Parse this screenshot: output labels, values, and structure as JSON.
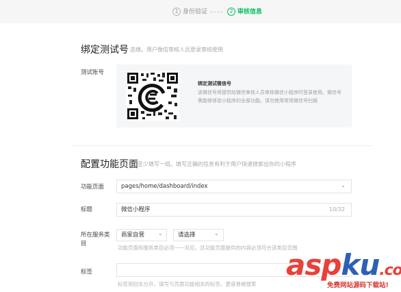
{
  "steps": {
    "step1_num": "1",
    "step1_label": "身份验证",
    "step2_num": "2",
    "step2_label": "审核信息"
  },
  "bind_tester": {
    "title": "绑定测试号",
    "hint": "选填。用户微信审核人员登录审核使用",
    "account_label": "测试账号",
    "qr_title": "绑定测试微信号",
    "qr_desc": "该微信号将提供给微信审核人员审核微信小程序时登录使用。微信号需能够体验小程序的全部功能。请勿使用常用微信号扫描"
  },
  "config_pages": {
    "title": "配置功能页面",
    "hint": "至少填写一组。填写正确的信息有利于用户快速搜索出你的小程序",
    "page_label": "功能页面",
    "page_value": "pages/home/dashboard/index",
    "title_label": "标题",
    "title_value": "微信小程序",
    "title_counter": "10/32",
    "category_label": "所在服务类目",
    "category_first": "商家自营",
    "category_second": "请选择",
    "category_hint": "功能页面和服务类目必须一一对应，且功能页面提供的内容必须符合该类目范围",
    "tags_label": "标签",
    "tags_value": "",
    "tags_hint": "标签用回车分开，填写与页面功能相关的标签，更容易被搜索"
  },
  "watermark": {
    "asp": "asp",
    "ku": "ku",
    "dot_com": ".com",
    "sub": "免费网站源码下载站!"
  },
  "colors": {
    "accent": "#07c160",
    "watermark_red": "#e8403a",
    "watermark_blue": "#2f5fb5"
  }
}
